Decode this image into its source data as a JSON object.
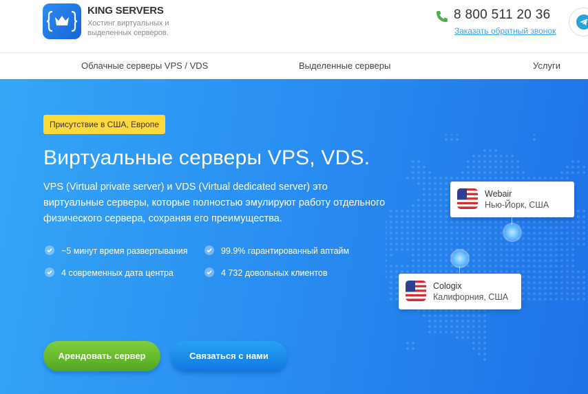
{
  "header": {
    "brand_name": "KING SERVERS",
    "brand_tagline": "Хостинг виртуальных и выделенных серверов.",
    "phone": "8 800 511 20 36",
    "callback_link": "Заказать обратный звонок"
  },
  "nav": {
    "items": [
      {
        "label": "Облачные серверы VPS / VDS"
      },
      {
        "label": "Выделенные серверы"
      },
      {
        "label": "Услуги"
      }
    ]
  },
  "hero": {
    "badge": "Присутствие в США, Европе",
    "title": "Виртуальные серверы VPS, VDS.",
    "description": "VPS (Virtual private server) и VDS (Virtual dedicated server) это виртуальные серверы, которые полностью эмулируют работу отдельного физического сервера, сохраняя его преимущества.",
    "features": [
      "~5 минут время развертывания",
      "99.9% гарантированный аптайм",
      "4 современных дата центра",
      "4 732 довольных клиентов"
    ],
    "primary_button": "Арендовать сервер",
    "secondary_button": "Связаться с нами"
  },
  "locations": [
    {
      "name": "Webair",
      "place": "Нью-Йорк, США"
    },
    {
      "name": "Cologix",
      "place": "Калифорния, США"
    }
  ],
  "colors": {
    "accent_blue": "#2a8ff2",
    "badge_yellow": "#ffd83a",
    "button_green": "#6bbf2f",
    "phone_green": "#4caf50",
    "link_blue": "#3ca3e6"
  }
}
